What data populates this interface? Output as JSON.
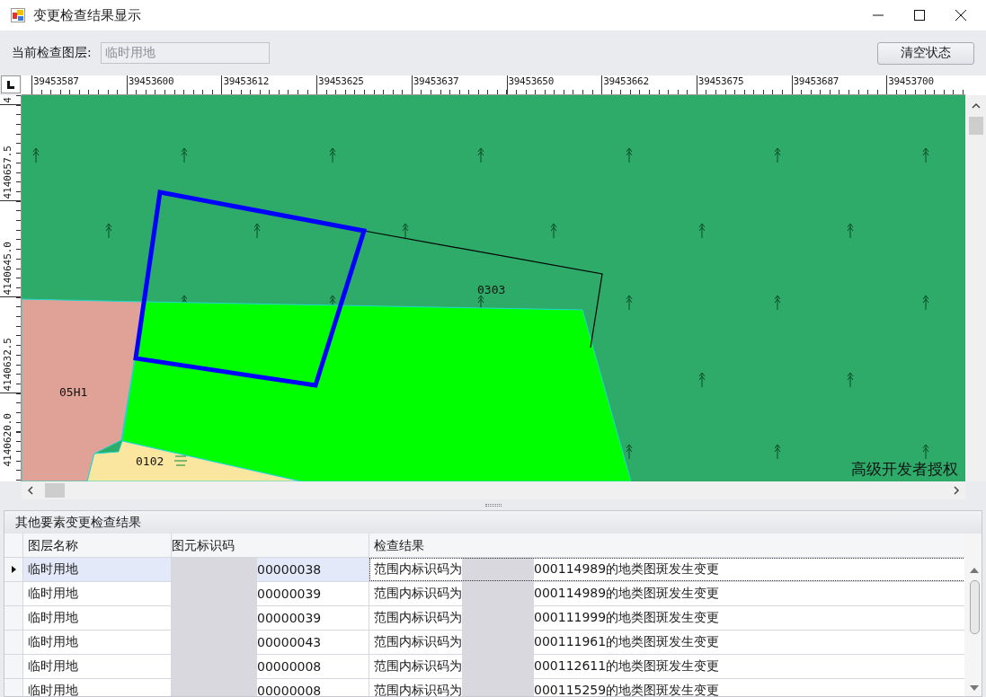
{
  "window": {
    "title": "变更检查结果显示"
  },
  "toolbar": {
    "layer_label": "当前检查图层:",
    "layer_value": "临时用地",
    "clear_button": "清空状态"
  },
  "ruler": {
    "x_labels": [
      "39453587",
      "39453600",
      "39453612",
      "39453625",
      "39453637",
      "39453650",
      "39453662",
      "39453675",
      "39453687",
      "39453700"
    ],
    "y_labels": [
      "4",
      "4140657.5",
      "4140645.0",
      "4140632.5",
      "4140620.0"
    ]
  },
  "map": {
    "parcel_labels": [
      "0303",
      "05H1",
      "0102"
    ],
    "license_text": "高级开发者授权"
  },
  "results": {
    "title": "其他要素变更检查结果",
    "columns": [
      "图层名称",
      "图元标识码",
      "检查结果"
    ],
    "rows": [
      {
        "selected": true,
        "layer": "临时用地",
        "id": "00000038",
        "result_prefix": "范围内标识码为",
        "result_suffix": "000114989的地类图斑发生变更"
      },
      {
        "selected": false,
        "layer": "临时用地",
        "id": "00000039",
        "result_prefix": "范围内标识码为",
        "result_suffix": "000114989的地类图斑发生变更"
      },
      {
        "selected": false,
        "layer": "临时用地",
        "id": "00000039",
        "result_prefix": "范围内标识码为",
        "result_suffix": "000111999的地类图斑发生变更"
      },
      {
        "selected": false,
        "layer": "临时用地",
        "id": "00000043",
        "result_prefix": "范围内标识码为",
        "result_suffix": "000111961的地类图斑发生变更"
      },
      {
        "selected": false,
        "layer": "临时用地",
        "id": "00000008",
        "result_prefix": "范围内标识码为",
        "result_suffix": "000112611的地类图斑发生变更"
      },
      {
        "selected": false,
        "layer": "临时用地",
        "id": "00000008",
        "result_prefix": "范围内标识码为",
        "result_suffix": "000115259的地类图斑发生变更"
      }
    ]
  }
}
